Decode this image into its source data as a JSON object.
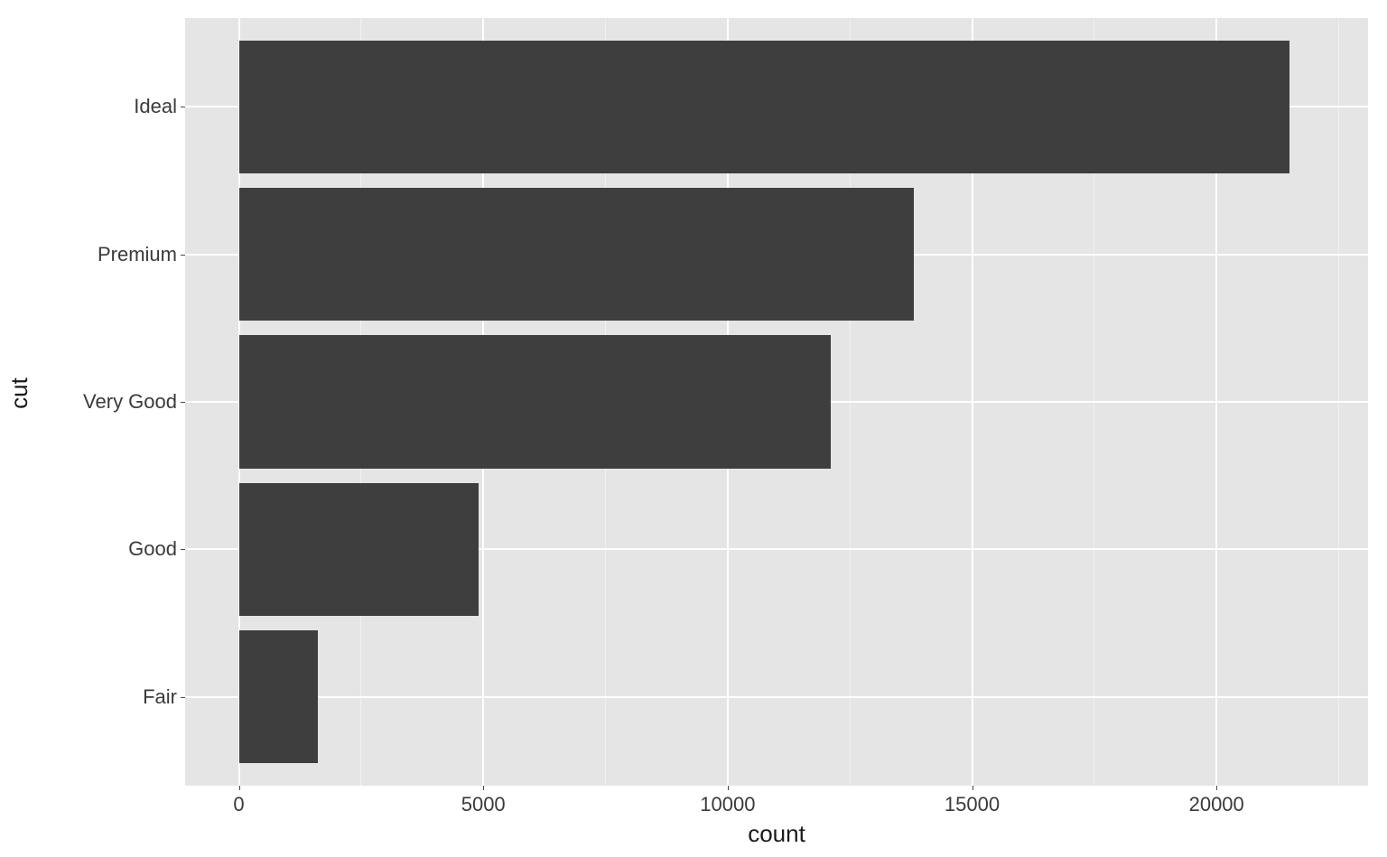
{
  "chart_data": {
    "type": "bar",
    "orientation": "horizontal",
    "categories": [
      "Fair",
      "Good",
      "Very Good",
      "Premium",
      "Ideal"
    ],
    "values": [
      1610,
      4900,
      12100,
      13800,
      21500
    ],
    "xlabel": "count",
    "ylabel": "cut",
    "xlim": [
      0,
      22000
    ],
    "x_ticks": [
      0,
      5000,
      10000,
      15000,
      20000
    ],
    "bar_fill": "#3e3e3e",
    "panel_bg": "#e5e5e5",
    "grid_major": "#ffffff"
  }
}
